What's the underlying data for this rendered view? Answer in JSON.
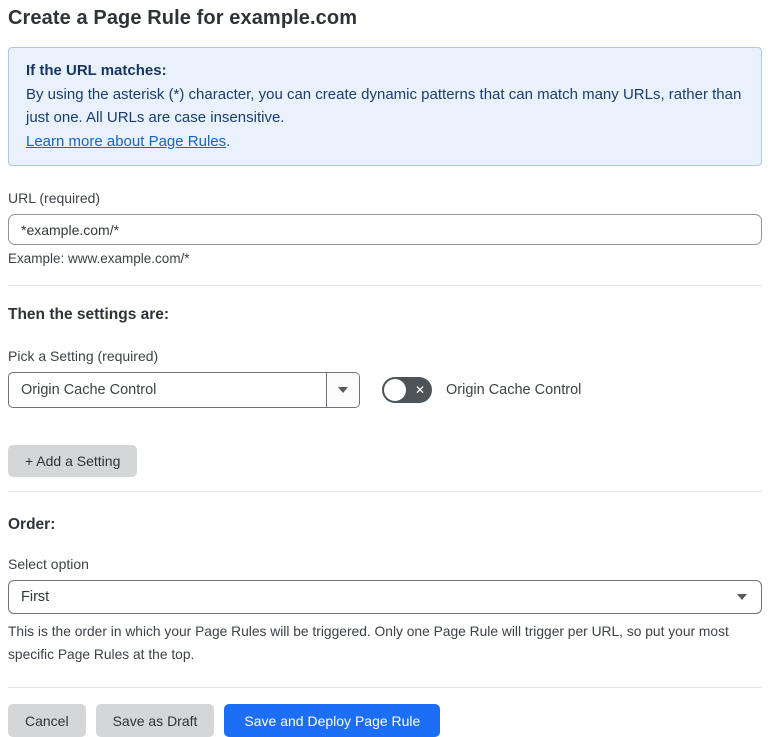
{
  "page": {
    "title": "Create a Page Rule for example.com"
  },
  "info_box": {
    "heading": "If the URL matches:",
    "body": "By using the asterisk (*) character, you can create dynamic patterns that can match many URLs, rather than just one. All URLs are case insensitive.",
    "link_label": "Learn more about Page Rules",
    "link_suffix": "."
  },
  "url_field": {
    "label": "URL (required)",
    "value": "*example.com/*",
    "helper": "Example: www.example.com/*"
  },
  "settings_section": {
    "heading": "Then the settings are:",
    "picker_label": "Pick a Setting (required)",
    "picker_value": "Origin Cache Control",
    "toggle_state": "off",
    "toggle_off_glyph": "✕",
    "toggle_label": "Origin Cache Control",
    "add_setting_label": "+ Add a Setting"
  },
  "order_section": {
    "heading": "Order:",
    "select_label": "Select option",
    "select_value": "First",
    "helper": "This is the order in which your Page Rules will be triggered. Only one Page Rule will trigger per URL, so put your most specific Page Rules at the top."
  },
  "footer": {
    "cancel_label": "Cancel",
    "save_draft_label": "Save as Draft",
    "save_deploy_label": "Save and Deploy Page Rule"
  },
  "colors": {
    "info_background": "#e9f2fc",
    "info_border": "#a9c9ef",
    "info_text": "#1d3c6e",
    "link": "#1863c6",
    "primary_button": "#1b6ef5",
    "gray_button": "#d5d6d7",
    "toggle_off_background": "#4e5358"
  }
}
